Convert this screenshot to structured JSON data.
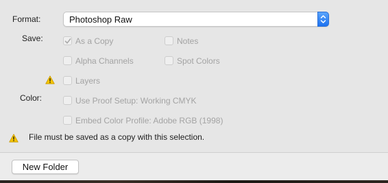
{
  "format": {
    "label": "Format:",
    "selected": "Photoshop Raw"
  },
  "save": {
    "label": "Save:",
    "options": {
      "as_a_copy": {
        "label": "As a Copy",
        "checked": true,
        "enabled": false
      },
      "notes": {
        "label": "Notes",
        "checked": false,
        "enabled": false
      },
      "alpha_channels": {
        "label": "Alpha Channels",
        "checked": false,
        "enabled": false
      },
      "spot_colors": {
        "label": "Spot Colors",
        "checked": false,
        "enabled": false
      },
      "layers": {
        "label": "Layers",
        "checked": false,
        "enabled": false
      }
    }
  },
  "color": {
    "label": "Color:",
    "options": {
      "use_proof_setup": {
        "label": "Use Proof Setup:  Working CMYK",
        "checked": false,
        "enabled": false
      },
      "embed_color_profile": {
        "label": "Embed Color Profile:  Adobe RGB (1998)",
        "checked": false,
        "enabled": false
      }
    }
  },
  "warning": {
    "message": "File must be saved as a copy with this selection.",
    "icon": "warning-triangle-icon"
  },
  "footer": {
    "new_folder_label": "New Folder"
  },
  "colors": {
    "accent": "#1d72f0",
    "warning": "#f5c400",
    "panel": "#e6e6e6",
    "disabled_text": "#a3a3a3"
  }
}
